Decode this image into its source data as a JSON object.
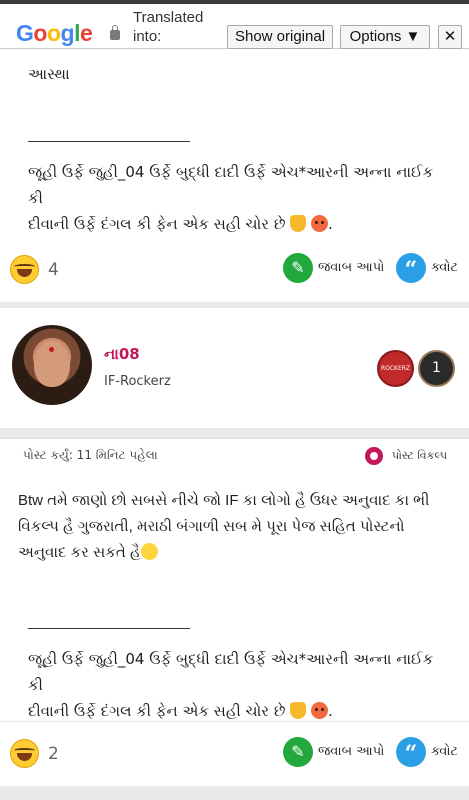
{
  "translate_bar": {
    "logo": [
      "G",
      "o",
      "o",
      "g",
      "l",
      "e"
    ],
    "translated_into": "Translated into:",
    "show_original": "Show original",
    "options": "Options ▼",
    "close": "✕"
  },
  "post1": {
    "line_top": "આસ્થા",
    "signature_line1": "જૂહી ઉર્ફે જુહી_04 ઉર્ફે બુદ્ધી દાદી ઉર્ફે એચ*આરની અન્ના નાઈક કી",
    "signature_line2": "દીવાની ઉર્ફે દંગલ કી ફેન એક સહી ચોર છે",
    "reaction_count": "4",
    "reply_label": "જવાબ આપો",
    "quote_label": "ક્વોટ"
  },
  "post2": {
    "username": "ના08",
    "user_title": "IF-Rockerz",
    "badge_text": "ROCKERZ",
    "badge_rank": "1",
    "posted": "પોસ્ટ કર્યું: 11 મિનિટ પહેલા",
    "post_options": "પોસ્ટ વિકલ્પ",
    "body_line1": "Btw તમે જાણો છો સબસે નીચે જો IF કા લોગો હૈ ઉધર અનુવાદ કા ભી",
    "body_line2": "વિકલ્પ હૈ ગુજરાતી, મરાઠી બંગાળી સબ મે પૂરા પેજ સહિત પોસ્ટનો",
    "body_line3": "અનુવાદ કર સકતે હૈ",
    "signature_line1": "જૂહી ઉર્ફે જુહી_04 ઉર્ફે બુદ્ધી દાદી ઉર્ફે એચ*આરની અન્ના નાઈક કી",
    "signature_line2": "દીવાની ઉર્ફે દંગલ કી ફેન એક સહી ચોર છે",
    "reaction_count": "2",
    "reply_label": "જવાબ આપો",
    "quote_label": "ક્વોટ"
  },
  "icons": {
    "reply": "pencil-icon",
    "quote": "quote-icon",
    "options": "gear-icon",
    "reaction": "laughing-emoji-icon"
  },
  "colors": {
    "username": "#c4165a",
    "reply_button": "#22a83c",
    "quote_button": "#2b9fe6"
  }
}
